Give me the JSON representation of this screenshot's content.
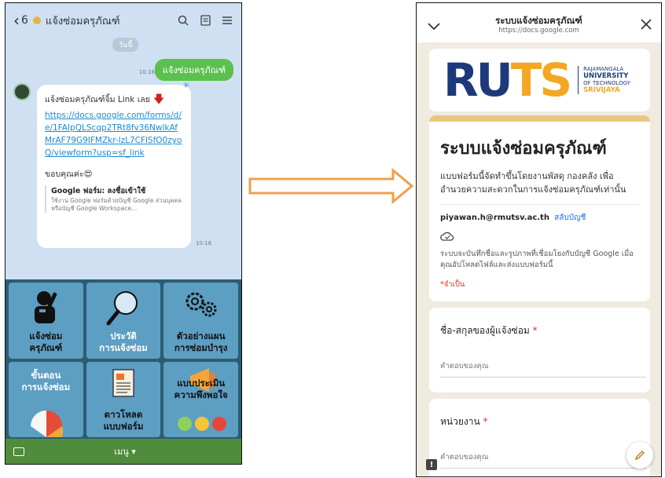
{
  "line_chat": {
    "back_count": "6",
    "title": "แจ้งซ่อมครุภัณฑ์",
    "date_chip": "วันนี้",
    "outgoing": {
      "text": "แจ้งซ่อมครุภัณฑ์",
      "time": "10:16"
    },
    "incoming": {
      "intro": "แจ้งซ่อมครุภัณฑ์จิ้ม Link เลย",
      "link": "https://docs.google.com/forms/d/e/1FAIpQLScqp2TRt8fv36NwlkAfMrAF79G9IFMZkr-lzL7CFlSfO0zyoQ/viewform?usp=sf_link",
      "thanks": "ขอบคุณค่ะ😍",
      "preview_title": "Google ฟอร์ม: ลงชื่อเข้าใช้",
      "preview_desc": "ใช้งาน Google ฟอร์มด้วยบัญชี Google ส่วนบุคคลหรือบัญชี Google Workspace...",
      "time": "10:16"
    },
    "menu_tiles": [
      {
        "label": "แจ้งซ่อม\nครุภัณฑ์",
        "icon": "mechanic-icon"
      },
      {
        "label": "ประวัติ\nการแจ้งซ่อม",
        "icon": "magnifier-icon"
      },
      {
        "label": "ตัวอย่างแผน\nการซ่อมบำรุง",
        "icon": "gears-icon"
      },
      {
        "label": "ขั้นตอน\nการแจ้งซ่อม",
        "icon": "process-icon"
      },
      {
        "label": "ดาวโหลด\nแบบฟอร์ม",
        "icon": "document-icon"
      },
      {
        "label": "แบบประเมิน\nความพึงพอใจ",
        "icon": "megaphone-icon"
      }
    ],
    "bottom_menu": "เมนู ▾"
  },
  "google_form": {
    "topbar_title": "ระบบแจ้งซ่อมครุภัณฑ์",
    "topbar_url": "https://docs.google.com",
    "logo": {
      "ruts_ru": "RU",
      "ruts_ts": "TS",
      "line1": "RAJAMANGALA",
      "line2": "UNIVERSITY",
      "line3": "OF TECHNOLOGY",
      "line4": "SRIVIJAYA"
    },
    "form_title": "ระบบแจ้งซ่อมครุภัณฑ์",
    "form_desc": "แบบฟอร์มนี้จัดทำขึ้นโดยงานพัสดุ กองคลัง เพื่ออำนวยความสะดวกในการแจ้งซ่อมครุภัณฑ์เท่านั้น",
    "account_email": "piyawan.h@rmutsv.ac.th",
    "switch_account": "สลับบัญชี",
    "save_note": "ระบบจะบันทึกชื่อและรูปภาพที่เชื่อมโยงกับบัญชี Google เมื่อคุณอัปโหลดไฟล์และส่งแบบฟอร์มนี้",
    "required_note": "*จำเป็น",
    "questions": [
      {
        "title": "ชื่อ-สกุลของผู้แจ้งซ่อม",
        "required": "*",
        "placeholder": "คำตอบของคุณ"
      },
      {
        "title": "หน่วยงาน",
        "required": "*",
        "placeholder": "คำตอบของคุณ"
      }
    ]
  },
  "colors": {
    "line_bg": "#cfe0f2",
    "line_green": "#5cc04e",
    "menu_tile": "#5d9ec3",
    "arrow_orange": "#f0a04b",
    "form_accent": "#e8c881",
    "ruts_blue": "#1c3a7a",
    "ruts_orange": "#f5a623"
  }
}
